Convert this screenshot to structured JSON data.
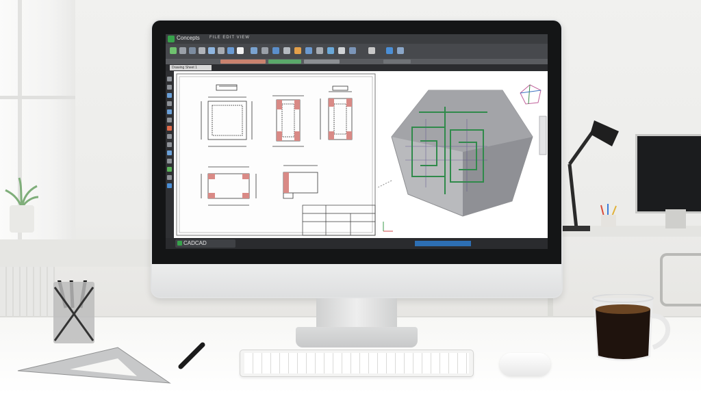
{
  "app": {
    "title": "Concepts",
    "menu": "FILE EDIT VIEW",
    "drawing_tab": "Drawing Sheet 1",
    "taskbar_label": "CADCAD"
  },
  "colors": {
    "app_green": "#37a24b",
    "toolbar_dark": "#47494d",
    "model_gray": "#9a9ba0",
    "wire_green": "#2f8a4a",
    "coffee": "#1f130d",
    "status_blue": "#2d6fb4"
  },
  "icons": [
    "app-logo-icon",
    "view-cube-icon",
    "pencil-icon",
    "coffee-mug-icon"
  ]
}
